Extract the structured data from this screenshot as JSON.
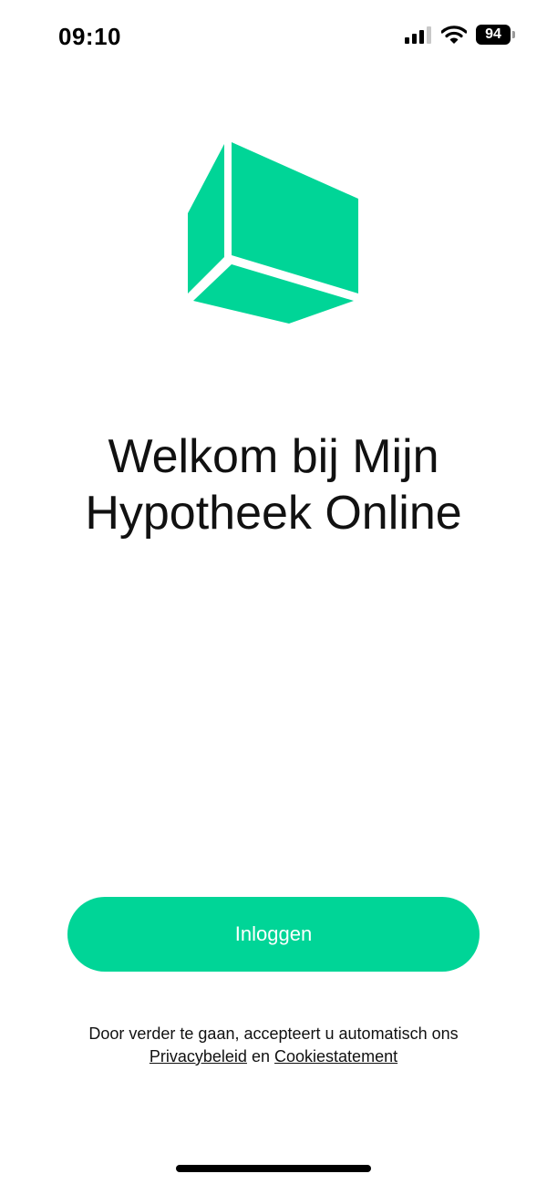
{
  "status_bar": {
    "time": "09:10",
    "battery": "94",
    "icons": [
      "signal-icon",
      "wifi-icon",
      "battery-icon"
    ]
  },
  "logo": {
    "icon": "box-logo-icon",
    "color": "#00d597"
  },
  "welcome": {
    "line1": "Welkom bij Mijn",
    "line2": "Hypotheek Online"
  },
  "login_button": {
    "label": "Inloggen",
    "color": "#00d597"
  },
  "consent": {
    "text": "Door verder te gaan, accepteert u automatisch ons",
    "privacy_link": "Privacybeleid",
    "conjunction": "en",
    "cookie_link": "Cookiestatement"
  }
}
